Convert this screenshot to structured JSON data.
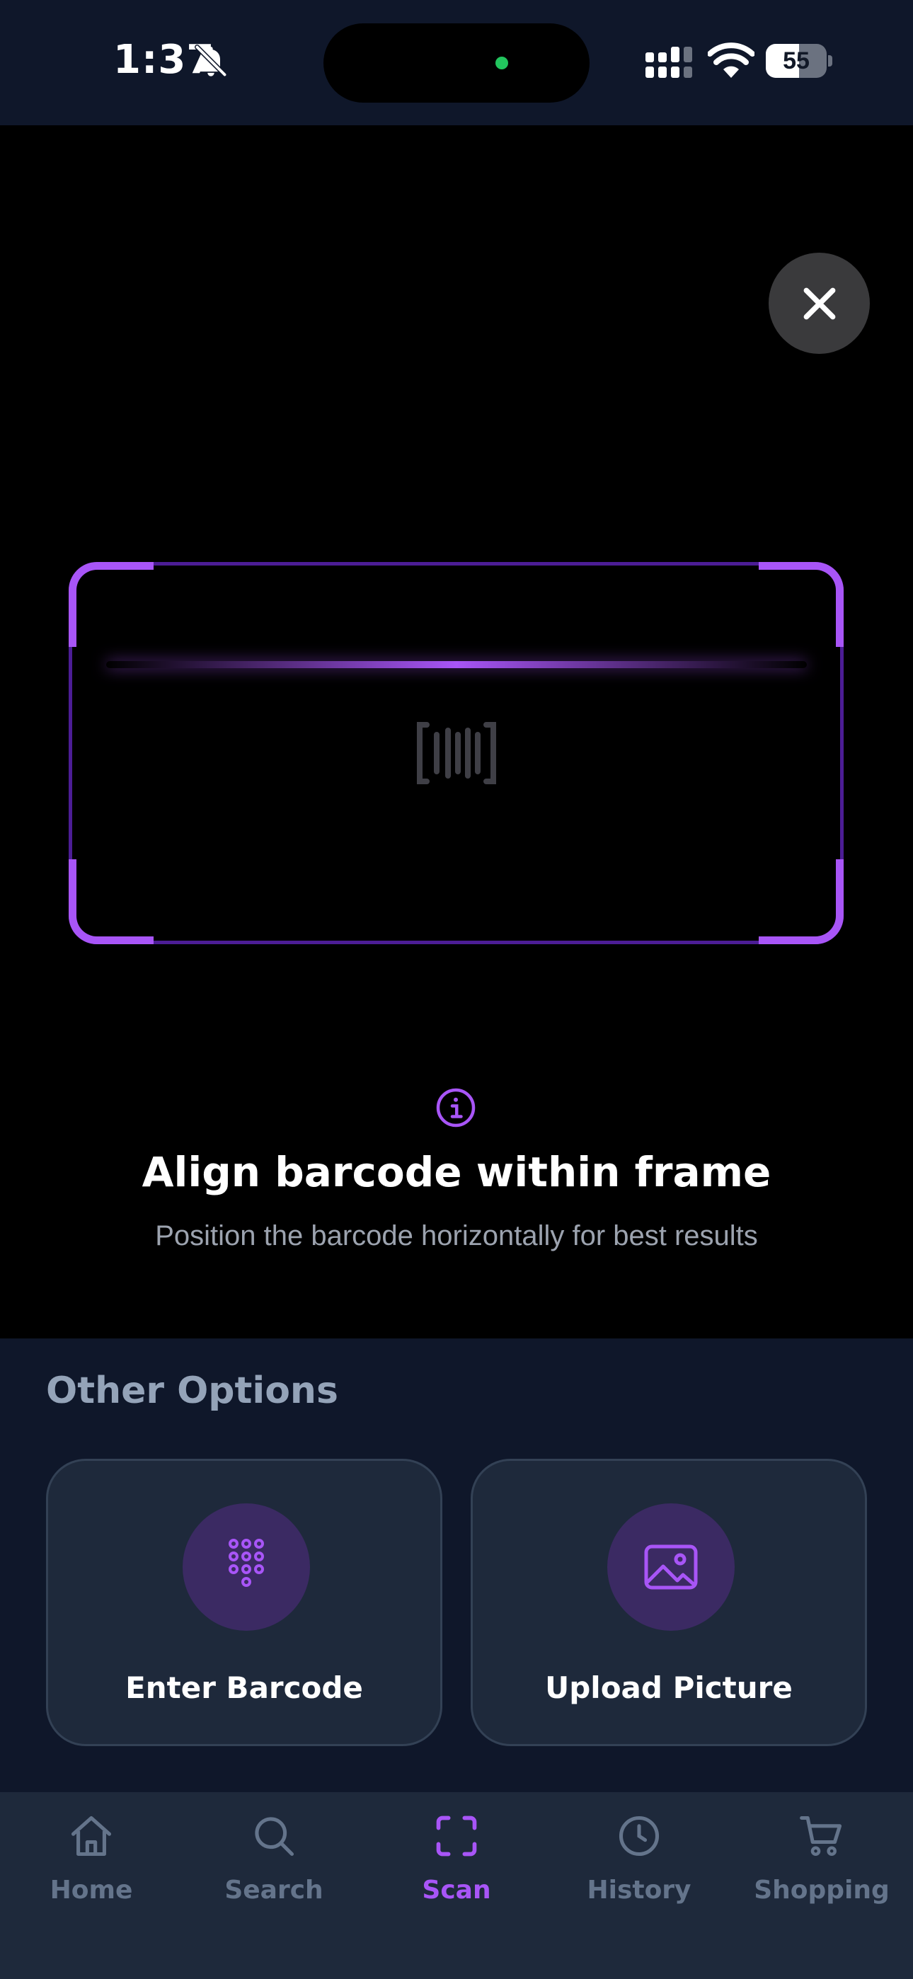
{
  "status_bar": {
    "time": "1:37",
    "battery_level": 55,
    "battery_label": "55"
  },
  "scanner": {
    "title": "Align barcode within frame",
    "subtitle": "Position the barcode horizontally for best results"
  },
  "options": {
    "heading": "Other Options",
    "items": [
      {
        "label": "Enter Barcode",
        "icon": "dialpad-icon"
      },
      {
        "label": "Upload Picture",
        "icon": "image-icon"
      }
    ]
  },
  "tab_bar": {
    "active": "Scan",
    "items": [
      {
        "label": "Home",
        "icon": "home-icon"
      },
      {
        "label": "Search",
        "icon": "search-icon"
      },
      {
        "label": "Scan",
        "icon": "scan-icon"
      },
      {
        "label": "History",
        "icon": "history-icon"
      },
      {
        "label": "Shopping",
        "icon": "cart-icon"
      }
    ]
  },
  "colors": {
    "accent": "#a855f7",
    "panel": "#0f172a",
    "card": "#1e293b",
    "muted": "#64748b"
  }
}
